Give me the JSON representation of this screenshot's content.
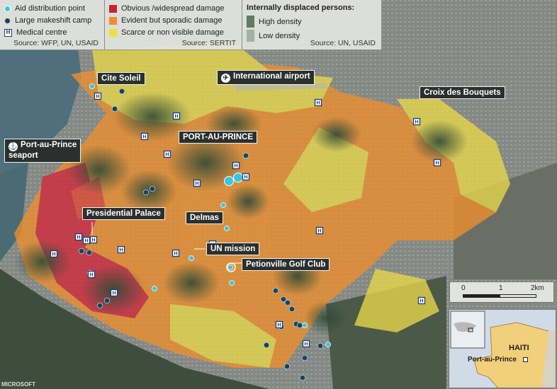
{
  "legend_points": {
    "aid": "Aid distribution point",
    "camp": "Large makeshift camp",
    "medical": "Medical centre",
    "source": "Source: WFP, UN, USAID"
  },
  "legend_damage": {
    "obvious": "Obvious /widespread damage",
    "evident": "Evident but sporadic damage",
    "scarce": "Scarce or non visible damage",
    "source": "Source: SERTIT"
  },
  "legend_idp": {
    "title": "Internally displaced persons:",
    "high": "High density",
    "low": "Low density",
    "source": "Source: UN, USAID"
  },
  "colors": {
    "aid": "#35c6e6",
    "camp": "#0f4763",
    "medical_border": "#1b3e78",
    "obvious": "#c8242b",
    "evident": "#ee8f2c",
    "scarce": "#f3df3a",
    "idp_high": "#5d7d5f",
    "idp_low": "#9fb49f"
  },
  "places": {
    "cite_soleil": "Cite Soleil",
    "airport": "International airport",
    "croix": "Croix des Bouquets",
    "port_au_prince": "PORT-AU-PRINCE",
    "seaport": "Port-au-Prince\nseaport",
    "presidential": "Presidential Palace",
    "delmas": "Delmas",
    "un_mission": "UN mission",
    "petionville": "Petionville Golf Club"
  },
  "icons": {
    "airport": "airplane-icon",
    "seaport": "anchor-icon"
  },
  "scale": {
    "ticks": [
      "0",
      "1",
      "2km"
    ]
  },
  "inset": {
    "country": "HAITI",
    "city": "Port-au-Prince"
  },
  "credit": "MICROSOFT"
}
